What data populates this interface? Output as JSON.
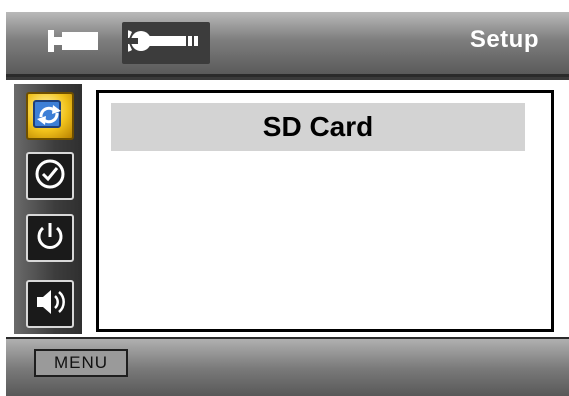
{
  "topbar": {
    "title": "Setup",
    "tabs": [
      {
        "icon": "video-camera-icon"
      },
      {
        "icon": "wrench-icon"
      }
    ]
  },
  "sidebar": {
    "items": [
      {
        "icon": "format-refresh-icon",
        "active": true
      },
      {
        "icon": "clock-icon",
        "active": false
      },
      {
        "icon": "power-icon",
        "active": false
      },
      {
        "icon": "speaker-icon",
        "active": false
      }
    ]
  },
  "main": {
    "items": [
      {
        "label": "SD Card",
        "selected": true
      }
    ]
  },
  "bottombar": {
    "menu_label": "MENU"
  },
  "colors": {
    "highlight": "#d3d3d3",
    "active_icon": "#f1c21b"
  }
}
